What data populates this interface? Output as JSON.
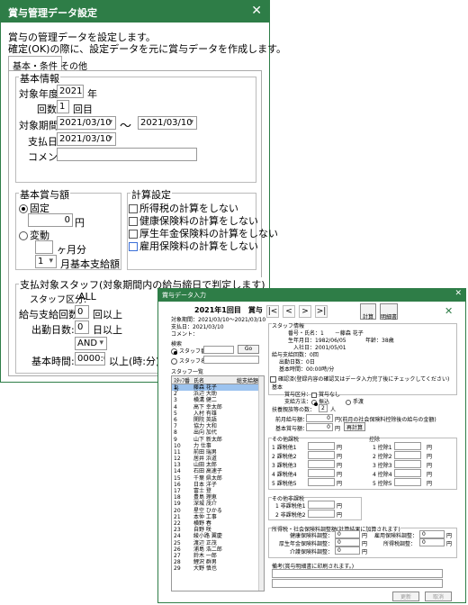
{
  "dlg": {
    "title": "賞与管理データ設定",
    "close": "✕",
    "intro1": "賞与の管理データを設定します。",
    "intro2": "確定(OK)の際に、設定データを元に賞与データを作成します。",
    "tabs": [
      "基本・条件",
      "その他"
    ],
    "basic_title": "基本情報",
    "year_label": "対象年度:",
    "year": "2021",
    "year_unit": "年",
    "times_label": "回数:",
    "times": "1",
    "times_unit": "回目",
    "period_label": "対象期間:",
    "period_from": "2021/03/10",
    "tilde": "〜",
    "period_to": "2021/03/10",
    "pay_label": "支払日:",
    "pay": "2021/03/10",
    "comment_label": "コメント:",
    "base_title": "基本賞与額",
    "fixed": "固定",
    "fixed_val": "0",
    "yen": "円",
    "variable": "変動",
    "months_unit": "ヶ月分",
    "sel1": "1",
    "base_month": "月基本支給額",
    "calc_title": "計算設定",
    "calc": [
      "所得税の計算をしない",
      "健康保険料の計算をしない",
      "厚生年金保険料の計算をしない",
      "雇用保険料の計算をしない"
    ],
    "target_title": "支払対象スタッフ(対象期間内の給与締日で判定します)",
    "staff_cat_label": "スタッフ区分:",
    "staff_cat": "ALL",
    "pay_count_label": "給与支給回数:",
    "pay_count": "0",
    "pay_count_unit": "回以上",
    "days_label": "出勤日数:",
    "days": "0",
    "days_unit": "日以上",
    "and": "AND",
    "hours_label": "基本時間:",
    "hours": "0000:00",
    "hours_unit": "以上(時:分)"
  },
  "sub": {
    "title": "賞与データ入力",
    "close": "✕",
    "head": "2021年1回目　賞与",
    "period": "対象期間：2021/03/10〜2021/03/10",
    "pay": "支払日：2021/03/10",
    "comment": "コメント：",
    "search": "検索",
    "by_no": "スタッフ番号",
    "go": "Go",
    "by_name": "スタッフ名",
    "list_title": "スタッフ一覧",
    "cols": [
      "ｽﾀｯﾌ番号",
      "氏名",
      "総支給額"
    ],
    "rows": [
      "藤森 花子",
      "浜辺 大助",
      "横溝 健二",
      "高下 幸太郎",
      "入村 有雄",
      "関院 英語",
      "協力 大和",
      "出向 加代",
      "山下 新太郎",
      "力 仕事",
      "前田 瑞男",
      "居井 浜道",
      "山田 太郎",
      "石田 高速子",
      "千葉 県太郎",
      "日本 洋子",
      "富士 登",
      "豊島 理恵",
      "深城 茂介",
      "星空 ひかる",
      "本仲 工事",
      "横野 春",
      "自野 咲",
      "綾小路 翼慶",
      "渡辺 正茂",
      "浦島 浩二郎",
      "鈴木 一郎",
      "鯉沢 群男",
      "大野 慎也"
    ],
    "calc_btn": "計算",
    "print_btn": "明細書",
    "staff_info": "スタッフ情報",
    "no_name": "番号・氏名：1　　－藤森 花子",
    "birth": "生年月日：1982/06/05",
    "age": "年齢：38歳",
    "join": "入社日：2001/05/01",
    "pay_times": "給与支給回数：0回",
    "work_days": "出勤日数：0日",
    "basic_hours": "基本時間：00:00時/分",
    "confirm": "確認済(登録内容の確認又はデータ入力完了後にチェックしてください)",
    "basic": "基本",
    "pay_cat": "賞与区分：",
    "pay_cat_val": "賞与なし",
    "pay_method": "支給方法：",
    "transfer": "振込",
    "cash": "手渡",
    "dep": "扶養親族等の数：",
    "dep_val": "2",
    "dep_unit": "人",
    "prev_label": "前月給与額：",
    "prev_val": "0",
    "prev_note": "円(前月の社会保険料控除後の給与の金額)",
    "base_label": "基本賞与額：",
    "base_val": "0",
    "yen": "円",
    "recalc": "再計算",
    "other_taxable": "その他課税",
    "deduct": "控除",
    "taxable": [
      "1 課税他1",
      "2 課税他2",
      "3 課税他3",
      "4 課税他4",
      "5 課税他5"
    ],
    "deductions": [
      "1 控除1",
      "2 控除2",
      "3 控除3",
      "4 控除4",
      "5 控除5"
    ],
    "other_nontax": "その他非課税",
    "nontax": [
      "1 非課税他1",
      "2 非課税他2"
    ],
    "adj_title": "所得税・社会保険料調整額(計算結果に加算されます)",
    "adj_left": [
      "健康保険料調整：",
      "厚生年金保険料調整：",
      "介護保険料調整："
    ],
    "adj_right": [
      "雇用保険料調整：",
      "所得税調整："
    ],
    "note": "備考(賞与明細書に印刷されます。)",
    "update": "更新",
    "cancel": "取消"
  }
}
